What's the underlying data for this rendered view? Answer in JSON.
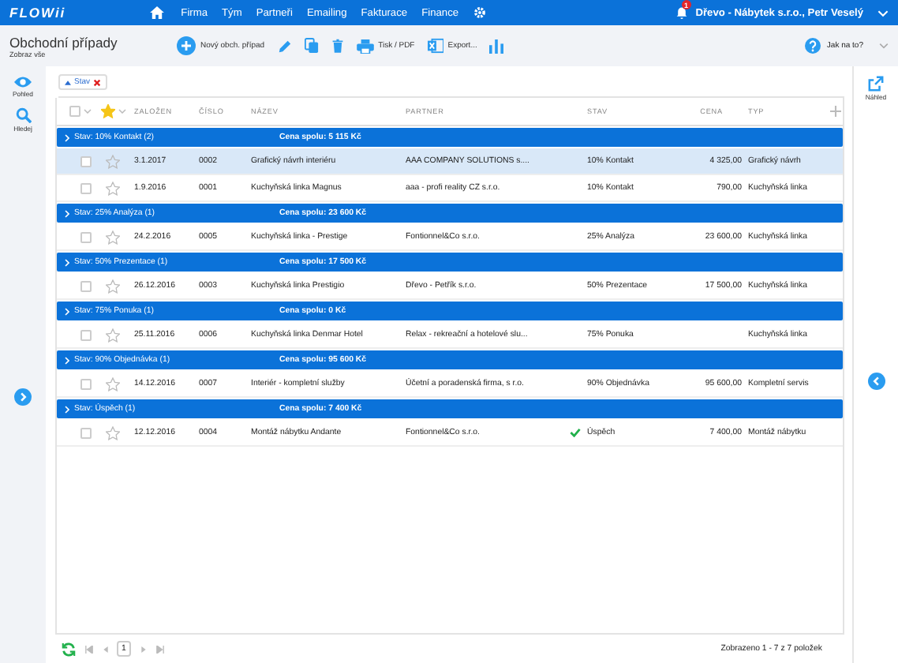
{
  "topbar": {
    "logo": "FLOWii",
    "nav": [
      "Firma",
      "Tým",
      "Partneři",
      "Emailing",
      "Fakturace",
      "Finance"
    ],
    "notifications": "1",
    "account": "Dřevo - Nábytek s.r.o., Petr Veselý"
  },
  "toolbar": {
    "title": "Obchodní případy",
    "subtitle": "Zobraz vše",
    "new_button": "Nový obch. případ",
    "print_button": "Tisk / PDF",
    "export_button": "Export...",
    "help": "Jak na to?"
  },
  "left_sidebar": [
    {
      "label": "Pohled",
      "kind": "eye"
    },
    {
      "label": "Hledej",
      "kind": "search"
    }
  ],
  "right_sidebar": {
    "label": "Náhled"
  },
  "filter_chip": {
    "label": "Stav"
  },
  "table": {
    "columns": [
      "ZALOŽEN",
      "ČÍSLO",
      "NÁZEV",
      "PARTNER",
      "STAV",
      "CENA",
      "TYP"
    ],
    "header_star_filter": true,
    "select_all_checked": false,
    "groups": [
      {
        "label": "Stav: 10% Kontakt (2)",
        "total": "Cena spolu: 5 115 Kč",
        "rows": [
          {
            "selected": true,
            "checked": false,
            "starred": false,
            "success": false,
            "cells": [
              "3.1.2017",
              "0002",
              "Grafický návrh interiéru",
              "AAA COMPANY SOLUTIONS s....",
              "10% Kontakt",
              "4 325,00",
              "Grafický návrh"
            ]
          },
          {
            "selected": false,
            "checked": false,
            "starred": false,
            "success": false,
            "cells": [
              "1.9.2016",
              "0001",
              "Kuchyňská linka Magnus",
              "aaa - profi reality CZ s.r.o.",
              "10% Kontakt",
              "790,00",
              "Kuchyňská linka"
            ]
          }
        ]
      },
      {
        "label": "Stav: 25% Analýza (1)",
        "total": "Cena spolu: 23 600 Kč",
        "rows": [
          {
            "selected": false,
            "checked": false,
            "starred": false,
            "success": false,
            "cells": [
              "24.2.2016",
              "0005",
              "Kuchyňská linka - Prestige",
              "Fontionnel&Co s.r.o.",
              "25% Analýza",
              "23 600,00",
              "Kuchyňská linka"
            ]
          }
        ]
      },
      {
        "label": "Stav: 50% Prezentace (1)",
        "total": "Cena spolu: 17 500 Kč",
        "rows": [
          {
            "selected": false,
            "checked": false,
            "starred": false,
            "success": false,
            "cells": [
              "26.12.2016",
              "0003",
              "Kuchyňská linka Prestigio",
              "Dřevo - Petřík s.r.o.",
              "50% Prezentace",
              "17 500,00",
              "Kuchyňská linka"
            ]
          }
        ]
      },
      {
        "label": "Stav: 75% Ponuka (1)",
        "total": "Cena spolu: 0 Kč",
        "rows": [
          {
            "selected": false,
            "checked": false,
            "starred": false,
            "success": false,
            "cells": [
              "25.11.2016",
              "0006",
              "Kuchyňská linka Denmar Hotel",
              "Relax - rekreační a hotelové slu...",
              "75% Ponuka",
              "",
              "Kuchyňská linka"
            ]
          }
        ]
      },
      {
        "label": "Stav: 90% Objednávka (1)",
        "total": "Cena spolu: 95 600 Kč",
        "rows": [
          {
            "selected": false,
            "checked": false,
            "starred": false,
            "success": false,
            "cells": [
              "14.12.2016",
              "0007",
              "Interiér - kompletní služby",
              "Účetní a poradenská firma, s r.o.",
              "90% Objednávka",
              "95 600,00",
              "Kompletní servis"
            ]
          }
        ]
      },
      {
        "label": "Stav: Úspěch (1)",
        "total": "Cena spolu: 7 400 Kč",
        "rows": [
          {
            "selected": false,
            "checked": false,
            "starred": false,
            "success": true,
            "cells": [
              "12.12.2016",
              "0004",
              "Montáž nábytku Andante",
              "Fontionnel&Co s.r.o.",
              "Úspěch",
              "7 400,00",
              "Montáž nábytku"
            ]
          }
        ]
      }
    ]
  },
  "pager": {
    "page": "1",
    "summary": "Zobrazeno 1 - 7 z 7 položek"
  }
}
